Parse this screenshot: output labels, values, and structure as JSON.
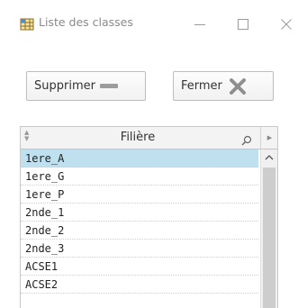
{
  "window": {
    "title": "Liste des classes",
    "app_icon": "grid-app-icon",
    "controls": [
      "minimize-icon",
      "maximize-icon",
      "close-icon"
    ]
  },
  "toolbar": {
    "delete_label": "Supprimer",
    "delete_icon": "minus-icon",
    "close_label": "Fermer",
    "close_icon": "x-icon"
  },
  "table": {
    "column_header": "Filière",
    "header_icons": [
      "sort-icon",
      "search-icon",
      "column-menu-arrow-icon"
    ],
    "selected_row": "1ere_A",
    "rows": [
      "1ere_A",
      "1ere_G",
      "1ere_P",
      "2nde_1",
      "2nde_2",
      "2nde_3",
      "ACSE1",
      "ACSE2"
    ]
  },
  "colors": {
    "selection": "#bfe0ee",
    "title_text": "#8a8a8a",
    "x_icon": "#8f8f8f"
  }
}
